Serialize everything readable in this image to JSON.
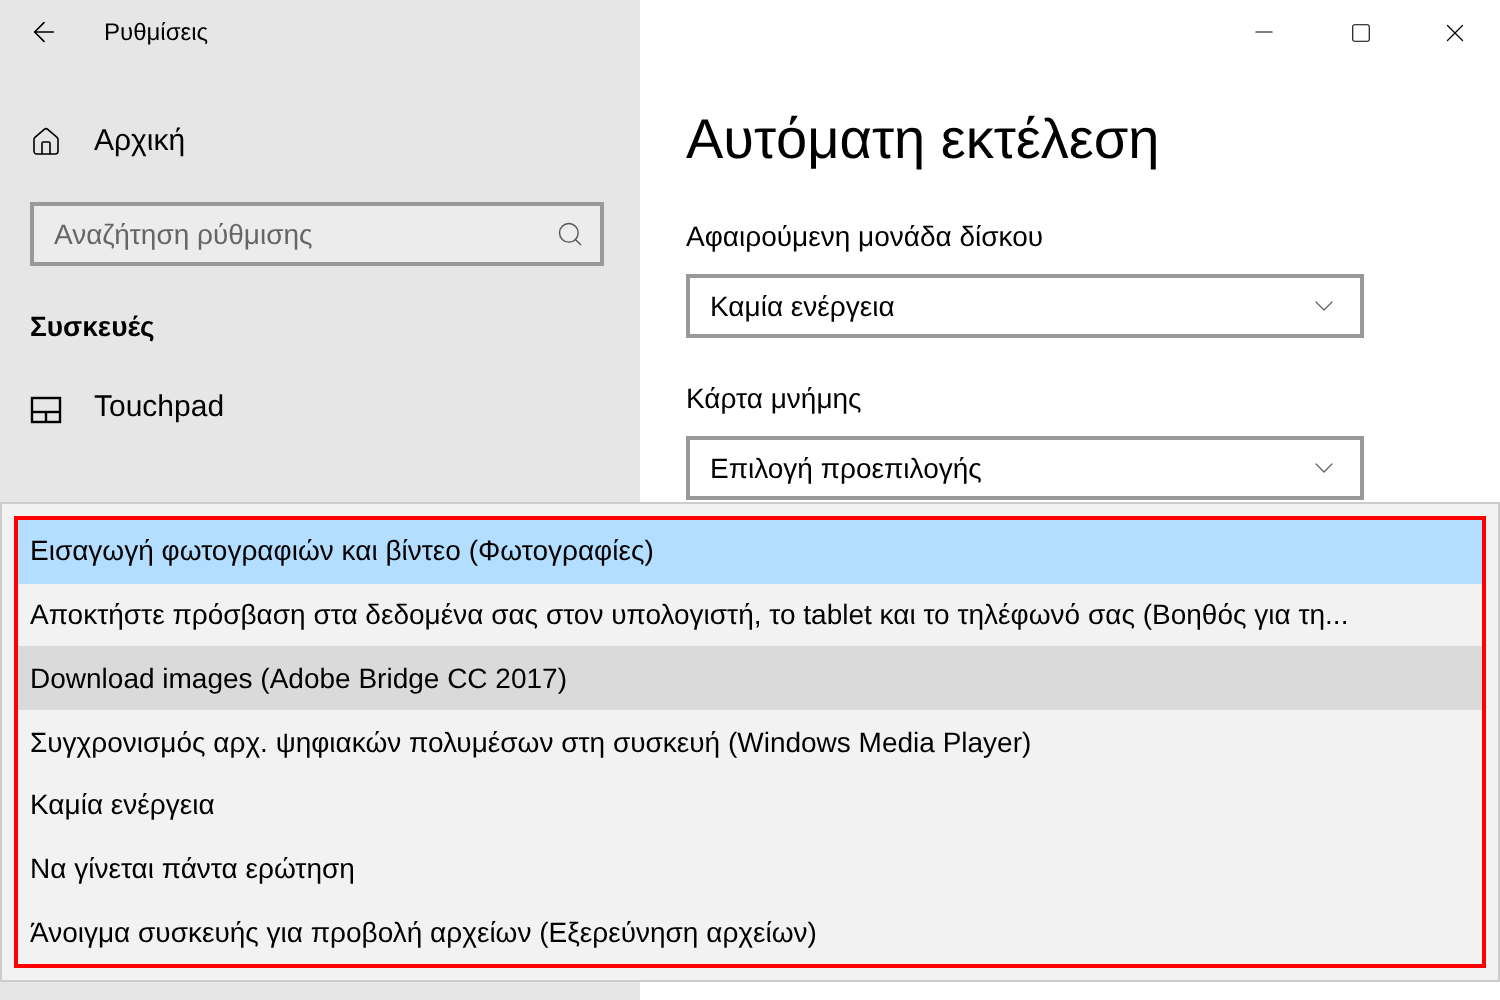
{
  "window": {
    "title": "Ρυθμίσεις"
  },
  "sidebar": {
    "home": "Αρχική",
    "search": {
      "placeholder": "Αναζήτηση ρύθμισης"
    },
    "section": "Συσκευές",
    "items": [
      {
        "label": "Touchpad",
        "kind": "touchpad"
      }
    ]
  },
  "main": {
    "title": "Αυτόματη εκτέλεση",
    "settings": [
      {
        "label": "Αφαιρούμενη μονάδα δίσκου",
        "value": "Καμία ενέργεια"
      },
      {
        "label": "Κάρτα μνήμης",
        "value": "Επιλογή προεπιλογής"
      }
    ]
  },
  "menu": {
    "items": [
      {
        "label": "Εισαγωγή φωτογραφιών και βίντεο (Φωτογραφίες)",
        "selected": true,
        "hovered": false
      },
      {
        "label": "Αποκτήστε πρόσβαση στα δεδομένα σας στον υπολογιστή, το tablet και το τηλέφωνό σας (Βοηθός για τη...",
        "selected": false,
        "hovered": false
      },
      {
        "label": "Download images (Adobe Bridge CC 2017)",
        "selected": false,
        "hovered": true
      },
      {
        "label": "Συγχρονισμός αρχ. ψηφιακών πολυμέσων στη συσκευή (Windows Media Player)",
        "selected": false,
        "hovered": false
      },
      {
        "label": "Καμία ενέργεια",
        "selected": false,
        "hovered": false
      },
      {
        "label": "Να γίνεται πάντα ερώτηση",
        "selected": false,
        "hovered": false
      },
      {
        "label": "Άνοιγμα συσκευής για προβολή αρχείων (Εξερεύνηση αρχείων)",
        "selected": false,
        "hovered": false
      }
    ]
  }
}
